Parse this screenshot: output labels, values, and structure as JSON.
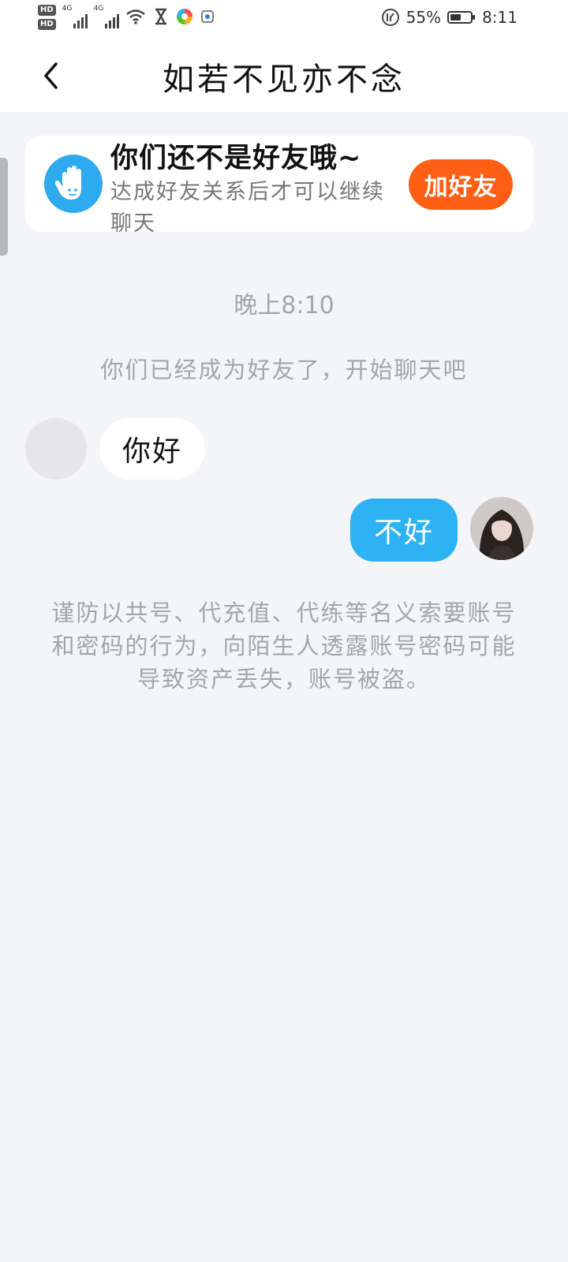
{
  "status_bar": {
    "hd1": "HD",
    "hd2": "HD",
    "net1": "4G",
    "net2": "4G",
    "battery_percent": "55%",
    "battery_level": 0.55,
    "time": "8:11"
  },
  "header": {
    "title": "如若不见亦不念"
  },
  "friend_card": {
    "title": "你们还不是好友哦~",
    "description": "达成好友关系后才可以继续聊天",
    "add_button": "加好友",
    "accent_color": "#ff5f14"
  },
  "chat": {
    "timestamp": "晚上8:10",
    "system_message": "你们已经成为好友了，开始聊天吧",
    "messages": [
      {
        "side": "left",
        "text": "你好"
      },
      {
        "side": "right",
        "text": "不好"
      }
    ],
    "security_notice": "谨防以共号、代充值、代练等名义索要账号和密码的行为，向陌生人透露账号密码可能导致资产丢失，账号被盗。"
  }
}
